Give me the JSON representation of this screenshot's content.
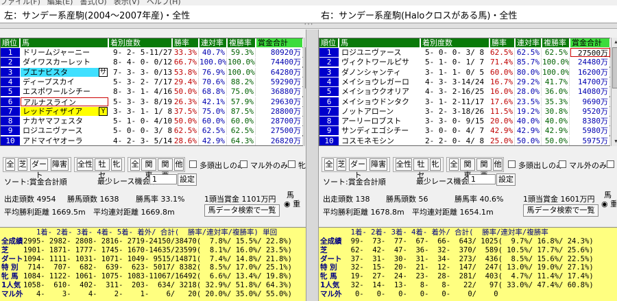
{
  "menu": [
    "ファイル(F)",
    "編集(E)",
    "書式(O)",
    "表示(V)",
    "ヘルプ(H)"
  ],
  "left_title": "左：サンデー系産駒(2004～2007年産)・全性",
  "right_title": "右：サンデー系産駒(Haloクロスがある馬)・全性",
  "splitter_glyph": "'''",
  "headers": {
    "no": "順位",
    "name": "馬",
    "record": "着別度数",
    "win": "勝率",
    "place": "連対率",
    "show": "複勝率",
    "prize": "賞金合計"
  },
  "left_rows": [
    {
      "no": "1",
      "name": "ドリームジャーニー",
      "mark": "",
      "record": "9- 2- 5-11/27",
      "win": "33.3%",
      "place": "40.7%",
      "show": "59.3%",
      "prize": "80920万"
    },
    {
      "no": "2",
      "name": "ダイワスカーレット",
      "mark": "",
      "record": "8- 4- 0- 0/12",
      "win": "66.7%",
      "place": "100.0%",
      "show": "100.0%",
      "prize": "74400万"
    },
    {
      "no": "3",
      "name": "ブエナビスタ",
      "mark": "サ",
      "record": "7- 3- 3- 0/13",
      "win": "53.8%",
      "place": "76.9%",
      "show": "100.0%",
      "prize": "64280万"
    },
    {
      "no": "4",
      "name": "ディープスカイ",
      "mark": "",
      "record": "5- 3- 2- 7/17",
      "win": "29.4%",
      "place": "70.6%",
      "show": "88.2%",
      "prize": "59290万"
    },
    {
      "no": "5",
      "name": "エスポワールシチー",
      "mark": "",
      "record": "8- 3- 1- 4/16",
      "win": "50.0%",
      "place": "68.8%",
      "show": "75.0%",
      "prize": "36880万"
    },
    {
      "no": "6",
      "name": "アルナスライン",
      "mark": "",
      "record": "5- 3- 3- 8/19",
      "win": "26.3%",
      "place": "42.1%",
      "show": "57.9%",
      "prize": "29630万"
    },
    {
      "no": "7",
      "name": "レッドディザイア",
      "mark": "Y",
      "record": "3- 3- 1- 1/ 8",
      "win": "37.5%",
      "place": "75.0%",
      "show": "87.5%",
      "prize": "28800万"
    },
    {
      "no": "8",
      "name": "ナカヤマフェスタ",
      "mark": "",
      "record": "5- 1- 0- 4/10",
      "win": "50.0%",
      "place": "60.0%",
      "show": "60.0%",
      "prize": "28700万"
    },
    {
      "no": "9",
      "name": "ロジユニヴァース",
      "mark": "",
      "record": "5- 0- 0- 3/ 8",
      "win": "62.5%",
      "place": "62.5%",
      "show": "62.5%",
      "prize": "27500万"
    },
    {
      "no": "10",
      "name": "アドマイヤオーラ",
      "mark": "",
      "record": "4- 2- 3- 5/14",
      "win": "28.6%",
      "place": "42.9%",
      "show": "64.3%",
      "prize": "26820万"
    }
  ],
  "right_rows": [
    {
      "no": "1",
      "name": "ロジユニヴァース",
      "record": "5- 0- 0- 3/ 8",
      "win": "62.5%",
      "place": "62.5%",
      "show": "62.5%",
      "prize": "27500万"
    },
    {
      "no": "2",
      "name": "ヴィクトワールピサ",
      "record": "5- 1- 0- 1/ 7",
      "win": "71.4%",
      "place": "85.7%",
      "show": "100.0%",
      "prize": "24480万"
    },
    {
      "no": "3",
      "name": "ダノンシャンティ",
      "record": "3- 1- 1- 0/ 5",
      "win": "60.0%",
      "place": "80.0%",
      "show": "100.0%",
      "prize": "16200万"
    },
    {
      "no": "4",
      "name": "メイショウレガーロ",
      "record": "4- 3- 3-14/24",
      "win": "16.7%",
      "place": "29.2%",
      "show": "41.7%",
      "prize": "14700万"
    },
    {
      "no": "5",
      "name": "メイショウクオリア",
      "record": "4- 3- 2-16/25",
      "win": "16.0%",
      "place": "28.0%",
      "show": "36.0%",
      "prize": "14080万"
    },
    {
      "no": "6",
      "name": "メイショウドンタク",
      "record": "3- 1- 2-11/17",
      "win": "17.6%",
      "place": "23.5%",
      "show": "35.3%",
      "prize": "9690万"
    },
    {
      "no": "7",
      "name": "ノットアローン",
      "record": "3- 2- 3-18/26",
      "win": "11.5%",
      "place": "19.2%",
      "show": "30.8%",
      "prize": "9520万"
    },
    {
      "no": "8",
      "name": "アーリーロブスト",
      "record": "3- 3- 0- 9/15",
      "win": "20.0%",
      "place": "40.0%",
      "show": "40.0%",
      "prize": "8380万"
    },
    {
      "no": "9",
      "name": "サンディエゴシチー",
      "record": "3- 0- 0- 4/ 7",
      "win": "42.9%",
      "place": "42.9%",
      "show": "42.9%",
      "prize": "5980万"
    },
    {
      "no": "10",
      "name": "コスモネモシン",
      "record": "2- 2- 0- 4/ 8",
      "win": "25.0%",
      "place": "50.0%",
      "show": "50.0%",
      "prize": "5975万"
    }
  ],
  "filters": {
    "all": "全",
    "turf": "芝",
    "dirt": "ダート",
    "jump": "障害",
    "sex_all": "全性",
    "male": "牡セ",
    "female": "牝",
    "region_all": "全",
    "kanto": "関東",
    "kansai": "関西",
    "other": "他",
    "multi": "多頭出しのみ",
    "maru_gai": "マル外のみ",
    "maru_chi": "牝"
  },
  "left_ctrl": {
    "sort": "ソート:賞金合計順",
    "min_label": "最少レース機会数",
    "min_value": "1",
    "set": "設定",
    "runners": "出走頭数 4954",
    "winners": "勝馬頭数 1638",
    "win_rate": "勝馬率 33.1%",
    "per_head": "1頭当賞金 1101万円",
    "avg_win": "平均勝利距離 1669.5m",
    "avg_place": "平均連対距離 1669.8m",
    "search": "馬データ検索で一覧",
    "side": "馬",
    "side_opt": "◉ 重"
  },
  "right_ctrl": {
    "sort": "ソート:賞金合計順",
    "min_label": "最少レース機会数",
    "min_value": "1",
    "set": "設定",
    "runners": "出走頭数 138",
    "winners": "勝馬頭数 56",
    "win_rate": "勝馬率 40.6%",
    "per_head": "1頭当賞金 1601万円",
    "avg_win": "平均勝利距離 1678.8m",
    "avg_place": "平均連対距離 1654.1m",
    "search": "馬データ検索で一覧",
    "side": "馬",
    "side_opt": "◉ 重"
  },
  "left_stats": {
    "header": "   1着- 2着- 3着- 4着- 5着- 着外/ 合計(  勝率/連対率/複勝率) 単回",
    "rows": [
      {
        "label": "全成績",
        "val": "2995- 2982- 2808- 2816- 2719-24150/38470(  7.8%/ 15.5%/ 22.8%)"
      },
      {
        "label": "芝",
        "val": "1901- 1871- 1777- 1745- 1670-14635/23599(  8.1%/ 16.0%/ 23.5%)"
      },
      {
        "label": "ダート",
        "val": "1094- 1111- 1031- 1071- 1049- 9515/14871(  7.4%/ 14.8%/ 21.8%)"
      },
      {
        "label": "特 別",
        "val": " 714-  707-  682-  639-  623- 5017/ 8382(  8.5%/ 17.0%/ 25.1%)"
      },
      {
        "label": "牝 馬",
        "val": "1084- 1122- 1061- 1075- 1083-11067/16492(  6.6%/ 13.4%/ 19.8%)"
      },
      {
        "label": "1人気",
        "val": "1058-  610-  402-  311-  203-  634/ 3218( 32.9%/ 51.8%/ 64.3%)"
      },
      {
        "label": "マル外",
        "val": "   4-    3-    4-    2-    1-    6/   20( 20.0%/ 35.0%/ 55.0%)"
      }
    ]
  },
  "right_stats": {
    "header": "  1着- 2着- 3着- 4着- 着外/ 合計(  勝率/連対率/複勝率",
    "rows": [
      {
        "label": "全成績",
        "val": "  99-  73-  77-  67-  66-  643/ 1025(  9.7%/ 16.8%/ 24.3%)"
      },
      {
        "label": "芝",
        "val": "  62-  42-  47-  36-  32-  370/  589( 10.5%/ 17.7%/ 25.6%)"
      },
      {
        "label": "ダート",
        "val": "  37-  31-  30-  31-  34-  273/  436(  8.5%/ 15.6%/ 22.5%)"
      },
      {
        "label": "特 別",
        "val": "  32-  15-  20-  21-  12-  147/  247( 13.0%/ 19.0%/ 27.1%)"
      },
      {
        "label": "牝 馬",
        "val": "  19-  27-  24-  23-  28-  281/  403(  4.7%/ 11.4%/ 17.4%)"
      },
      {
        "label": "1人気",
        "val": "  32-  14-  13-   8-   8-   22/   97( 33.0%/ 47.4%/ 60.8%)"
      },
      {
        "label": "マル外",
        "val": "   0-   0-   0-   0-   0-    0/    0"
      }
    ]
  }
}
